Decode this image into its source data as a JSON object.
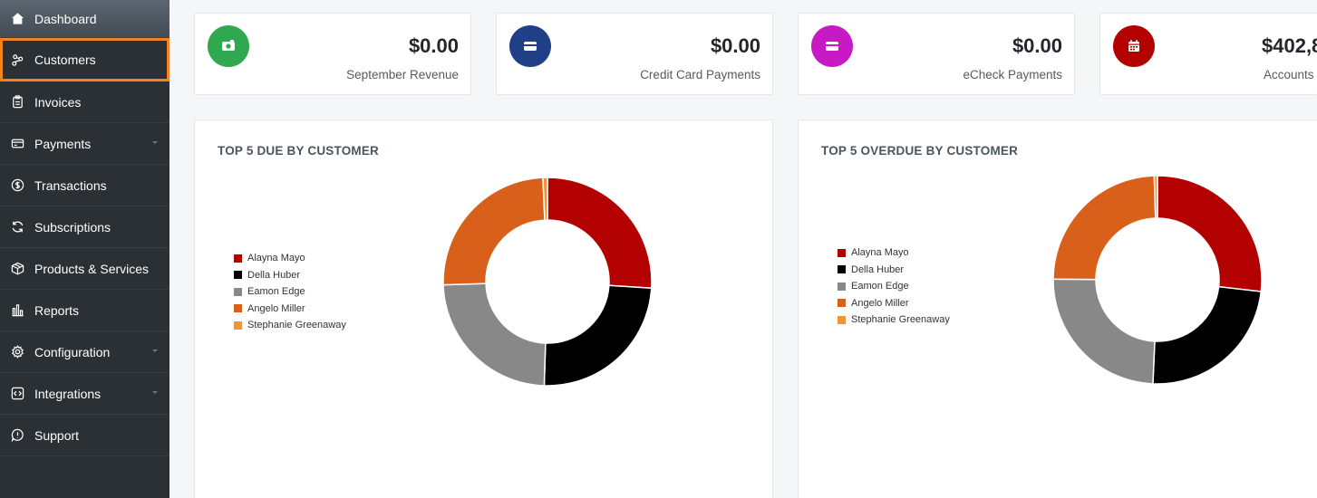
{
  "sidebar": {
    "items": [
      {
        "label": "Dashboard",
        "icon": "home-icon"
      },
      {
        "label": "Customers",
        "icon": "users-icon"
      },
      {
        "label": "Invoices",
        "icon": "clipboard-icon"
      },
      {
        "label": "Payments",
        "icon": "credit-card-icon"
      },
      {
        "label": "Transactions",
        "icon": "dollar-circle-icon"
      },
      {
        "label": "Subscriptions",
        "icon": "refresh-icon"
      },
      {
        "label": "Products & Services",
        "icon": "box-icon"
      },
      {
        "label": "Reports",
        "icon": "bar-chart-icon"
      },
      {
        "label": "Configuration",
        "icon": "gear-icon"
      },
      {
        "label": "Integrations",
        "icon": "code-icon"
      },
      {
        "label": "Support",
        "icon": "help-bubble-icon"
      }
    ],
    "active_item": "Customers"
  },
  "stats": [
    {
      "amount": "$0.00",
      "label": "September Revenue",
      "color": "#2fa84f",
      "icon": "money-icon"
    },
    {
      "amount": "$0.00",
      "label": "Credit Card Payments",
      "color": "#1f3f87",
      "icon": "credit-card-icon"
    },
    {
      "amount": "$0.00",
      "label": "eCheck Payments",
      "color": "#c81ac4",
      "icon": "credit-card-icon"
    },
    {
      "amount": "$402,8",
      "label": "Accounts R",
      "color": "#b30000",
      "icon": "calendar-icon"
    }
  ],
  "chart_data": [
    {
      "type": "pie",
      "title": "TOP 5 DUE BY CUSTOMER",
      "legend_position": "left",
      "categories": [
        "Alayna Mayo",
        "Della Huber",
        "Eamon Edge",
        "Angelo Miller",
        "Stephanie Greenaway"
      ],
      "values": [
        26,
        24.5,
        24,
        24.8,
        0.7
      ],
      "colors": [
        "#b30000",
        "#000000",
        "#888888",
        "#d9601a",
        "#f0953a"
      ]
    },
    {
      "type": "pie",
      "title": "TOP 5 OVERDUE BY CUSTOMER",
      "legend_position": "left",
      "categories": [
        "Alayna Mayo",
        "Della Huber",
        "Eamon Edge",
        "Angelo Miller",
        "Stephanie Greenaway"
      ],
      "values": [
        26.8,
        23.9,
        24.4,
        24.4,
        0.5
      ],
      "colors": [
        "#b30000",
        "#000000",
        "#888888",
        "#d9601a",
        "#f0953a"
      ]
    }
  ]
}
